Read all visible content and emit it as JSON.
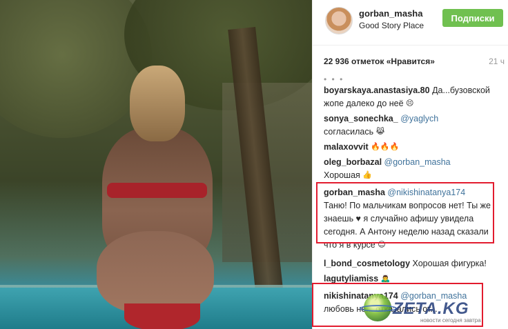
{
  "post": {
    "author": {
      "username": "gorban_masha",
      "location": "Good Story Place",
      "follow_label": "Подписки"
    },
    "likes": "22 936 отметок «Нравится»",
    "time": "21 ч",
    "more_comments": "• • •"
  },
  "comments": [
    {
      "user": "boyarskaya.anastasiya.80",
      "mention": "",
      "text": "Да...бузовской жопе далеко до неё",
      "emoji": "😣"
    },
    {
      "user": "sonya_sonechka_",
      "mention": "@yaglych",
      "text": "согласилась",
      "emoji": "😹"
    },
    {
      "user": "malaxovvit",
      "mention": "",
      "text": "",
      "emoji": "🔥🔥🔥"
    },
    {
      "user": "oleg_borbazal",
      "mention": "@gorban_masha",
      "text": "Хорошая",
      "emoji": "👍"
    },
    {
      "user": "gorban_masha",
      "mention": "@nikishinatanya174",
      "text": "Таню! По мальчикам вопросов нет! Ты же знаешь ♥ я случайно афишу увидела сегодня. А Антону неделю назад сказали что я в курсе",
      "emoji": "😊"
    },
    {
      "user": "l_bond_cosmetology",
      "mention": "",
      "text": "Хорошая фигурка!",
      "emoji": ""
    },
    {
      "user": "lagutyliamiss",
      "mention": "",
      "text": "",
      "emoji": "🙇‍♂"
    },
    {
      "user": "nikishinatanya174",
      "mention": "@gorban_masha",
      "text": "любовь не... отказались от...",
      "emoji": ""
    }
  ],
  "watermark": {
    "brand": "ZETA.KG",
    "tagline": "новости сегодня завтра"
  },
  "colors": {
    "follow_bg": "#70c050",
    "mention": "#3f729b",
    "highlight": "#e21b2e"
  }
}
